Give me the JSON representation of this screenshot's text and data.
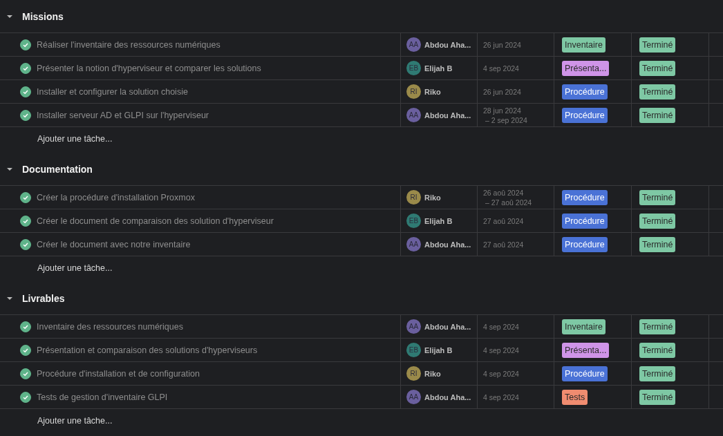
{
  "sections": [
    {
      "title": "Missions",
      "expanded": true,
      "add_label": "Ajouter une tâche...",
      "tasks": [
        {
          "name": "Réaliser l'inventaire des ressources numériques",
          "done": true,
          "assignee": {
            "initials": "AA",
            "name": "Abdou Aha...",
            "color": "#6a5f9e"
          },
          "date": "26 jun 2024",
          "tag": {
            "label": "Inventaire",
            "color": "#7ec8a4"
          },
          "status": {
            "label": "Terminé",
            "color": "#7ec8a4"
          }
        },
        {
          "name": "Présenter la notion d'hyperviseur et comparer les solutions",
          "done": true,
          "assignee": {
            "initials": "EB",
            "name": "Elijah B",
            "color": "#2f7a73"
          },
          "date": "4 sep 2024",
          "tag": {
            "label": "Présenta...",
            "color": "#cf94e8"
          },
          "status": {
            "label": "Terminé",
            "color": "#7ec8a4"
          }
        },
        {
          "name": "Installer et configurer la solution choisie",
          "done": true,
          "assignee": {
            "initials": "RI",
            "name": "Riko",
            "color": "#9a8a4a"
          },
          "date": "26 jun 2024",
          "tag": {
            "label": "Procédure",
            "color": "#4a72d6"
          },
          "status": {
            "label": "Terminé",
            "color": "#7ec8a4"
          }
        },
        {
          "name": "Installer serveur AD et GLPI sur l'hyperviseur",
          "done": true,
          "assignee": {
            "initials": "AA",
            "name": "Abdou Aha...",
            "color": "#6a5f9e"
          },
          "date": "28 jun 2024",
          "date_end": "– 2 sep 2024",
          "tag": {
            "label": "Procédure",
            "color": "#4a72d6"
          },
          "status": {
            "label": "Terminé",
            "color": "#7ec8a4"
          }
        }
      ]
    },
    {
      "title": "Documentation",
      "expanded": true,
      "add_label": "Ajouter une tâche...",
      "tasks": [
        {
          "name": "Créer la procédure d'installation Proxmox",
          "done": true,
          "assignee": {
            "initials": "RI",
            "name": "Riko",
            "color": "#9a8a4a"
          },
          "date": "26 aoû 2024",
          "date_end": "– 27 aoû 2024",
          "tag": {
            "label": "Procédure",
            "color": "#4a72d6"
          },
          "status": {
            "label": "Terminé",
            "color": "#7ec8a4"
          }
        },
        {
          "name": "Créer le document de comparaison des solution d'hyperviseur",
          "done": true,
          "assignee": {
            "initials": "EB",
            "name": "Elijah B",
            "color": "#2f7a73"
          },
          "date": "27 aoû 2024",
          "tag": {
            "label": "Procédure",
            "color": "#4a72d6"
          },
          "status": {
            "label": "Terminé",
            "color": "#7ec8a4"
          }
        },
        {
          "name": "Créer le document avec notre inventaire",
          "done": true,
          "assignee": {
            "initials": "AA",
            "name": "Abdou Aha...",
            "color": "#6a5f9e"
          },
          "date": "27 aoû 2024",
          "tag": {
            "label": "Procédure",
            "color": "#4a72d6"
          },
          "status": {
            "label": "Terminé",
            "color": "#7ec8a4"
          }
        }
      ]
    },
    {
      "title": "Livrables",
      "expanded": true,
      "add_label": "Ajouter une tâche...",
      "tasks": [
        {
          "name": "Inventaire des ressources numériques",
          "done": true,
          "assignee": {
            "initials": "AA",
            "name": "Abdou Aha...",
            "color": "#6a5f9e"
          },
          "date": "4 sep 2024",
          "tag": {
            "label": "Inventaire",
            "color": "#7ec8a4"
          },
          "status": {
            "label": "Terminé",
            "color": "#7ec8a4"
          }
        },
        {
          "name": "Présentation et comparaison des solutions d'hyperviseurs",
          "done": true,
          "assignee": {
            "initials": "EB",
            "name": "Elijah B",
            "color": "#2f7a73"
          },
          "date": "4 sep 2024",
          "tag": {
            "label": "Présenta...",
            "color": "#cf94e8"
          },
          "status": {
            "label": "Terminé",
            "color": "#7ec8a4"
          }
        },
        {
          "name": "Procédure d'installation et de configuration",
          "done": true,
          "assignee": {
            "initials": "RI",
            "name": "Riko",
            "color": "#9a8a4a"
          },
          "date": "4 sep 2024",
          "tag": {
            "label": "Procédure",
            "color": "#4a72d6"
          },
          "status": {
            "label": "Terminé",
            "color": "#7ec8a4"
          }
        },
        {
          "name": "Tests de gestion d'inventaire GLPI",
          "done": true,
          "assignee": {
            "initials": "AA",
            "name": "Abdou Aha...",
            "color": "#6a5f9e"
          },
          "date": "4 sep 2024",
          "tag": {
            "label": "Tests",
            "color": "#f08c70"
          },
          "status": {
            "label": "Terminé",
            "color": "#7ec8a4"
          }
        }
      ]
    }
  ]
}
